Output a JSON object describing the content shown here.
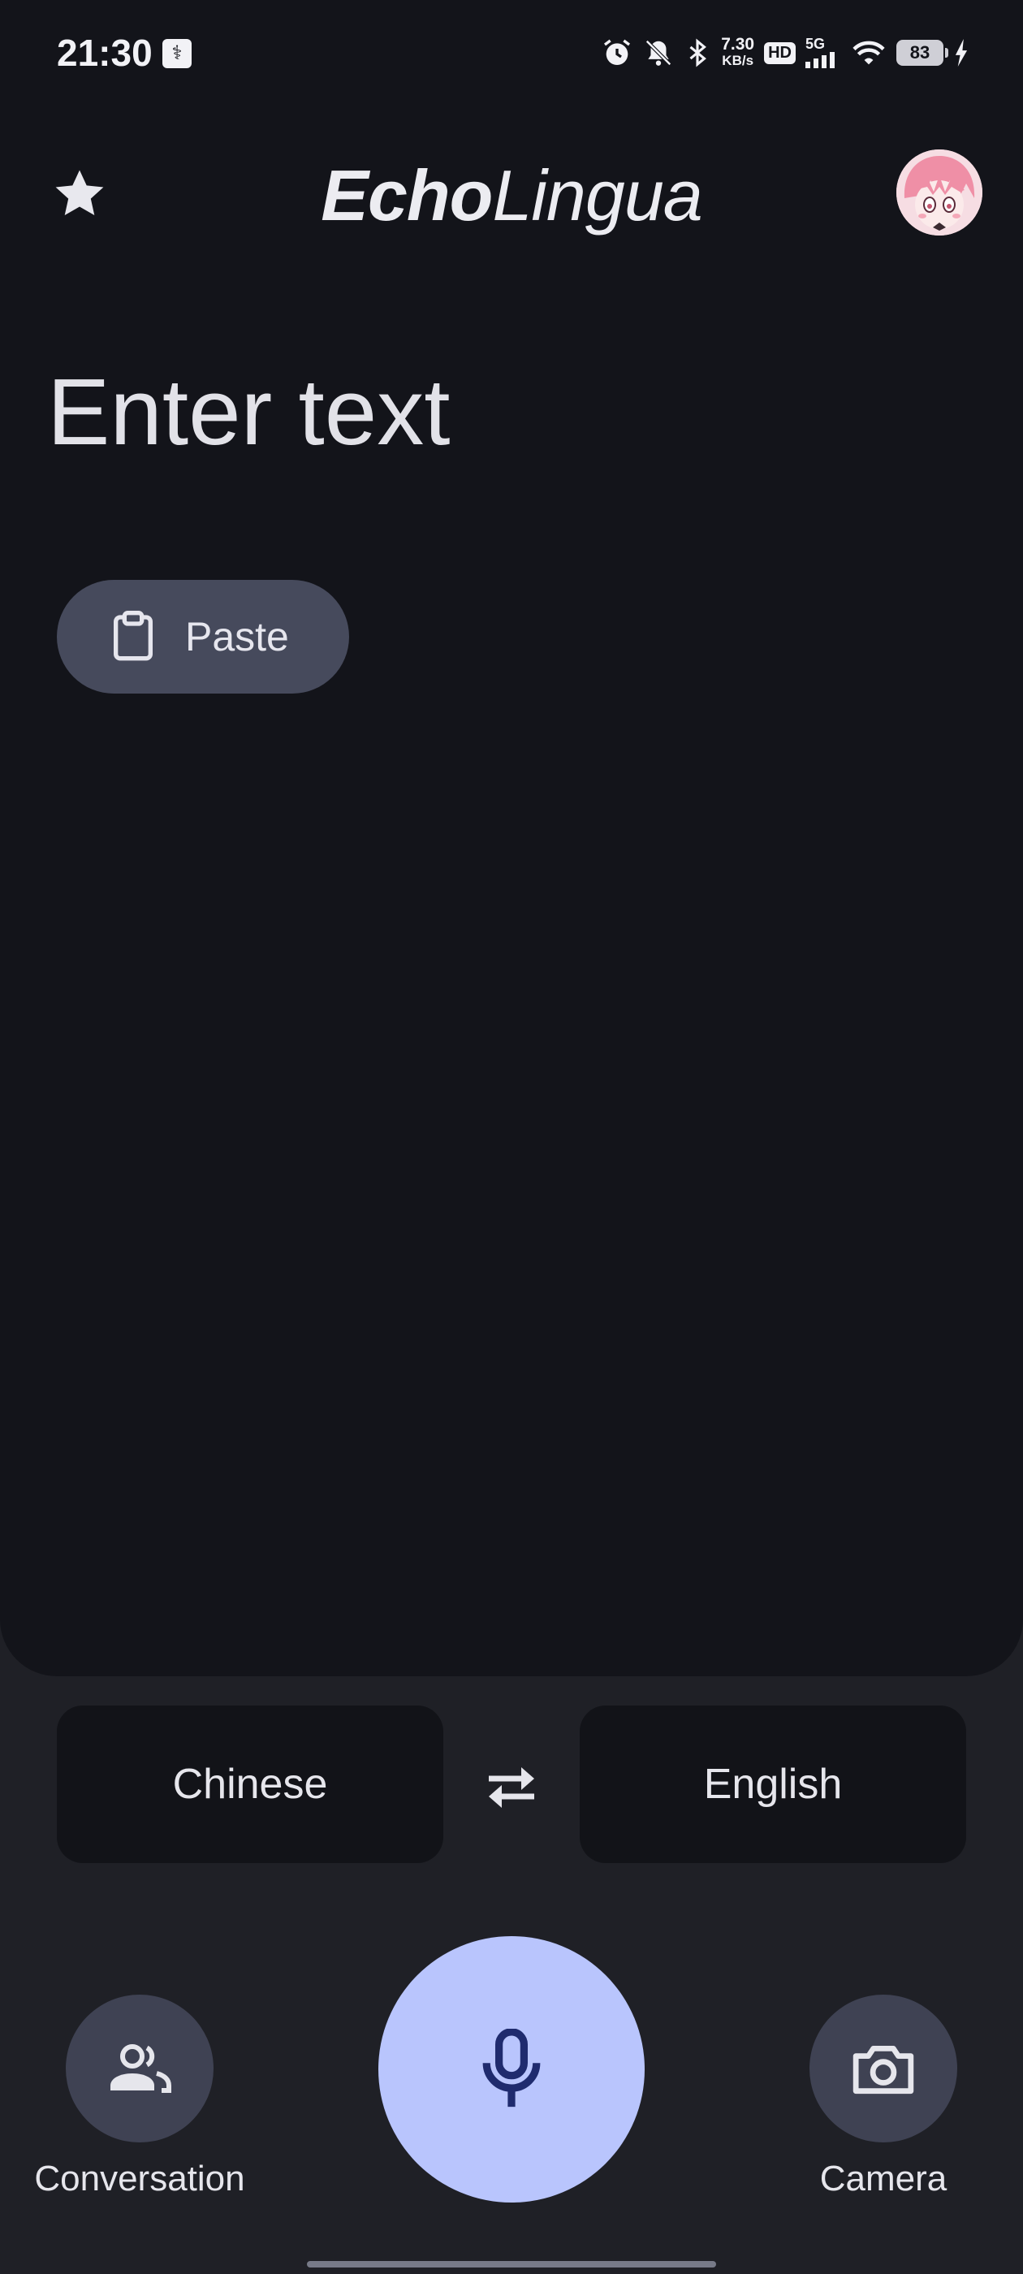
{
  "status_bar": {
    "time": "21:30",
    "usb_icon": "usb-debug-icon",
    "net_speed_value": "7.30",
    "net_speed_unit": "KB/s",
    "hd_label": "HD",
    "network": "5G",
    "battery": "83"
  },
  "header": {
    "favorites_icon": "star-icon",
    "title_bold": "Echo",
    "title_regular": "Lingua",
    "avatar_icon": "avatar"
  },
  "input": {
    "placeholder": "Enter text",
    "paste_label": "Paste",
    "paste_icon": "clipboard-icon"
  },
  "languages": {
    "source": "Chinese",
    "target": "English",
    "swap_icon": "swap-arrows-icon"
  },
  "actions": {
    "conversation_label": "Conversation",
    "conversation_icon": "people-icon",
    "camera_label": "Camera",
    "camera_icon": "camera-icon",
    "mic_icon": "microphone-icon"
  },
  "colors": {
    "background": "#1f2026",
    "panel": "#13141a",
    "mic_accent": "#b9c5fd",
    "chip": "#464a5c"
  }
}
